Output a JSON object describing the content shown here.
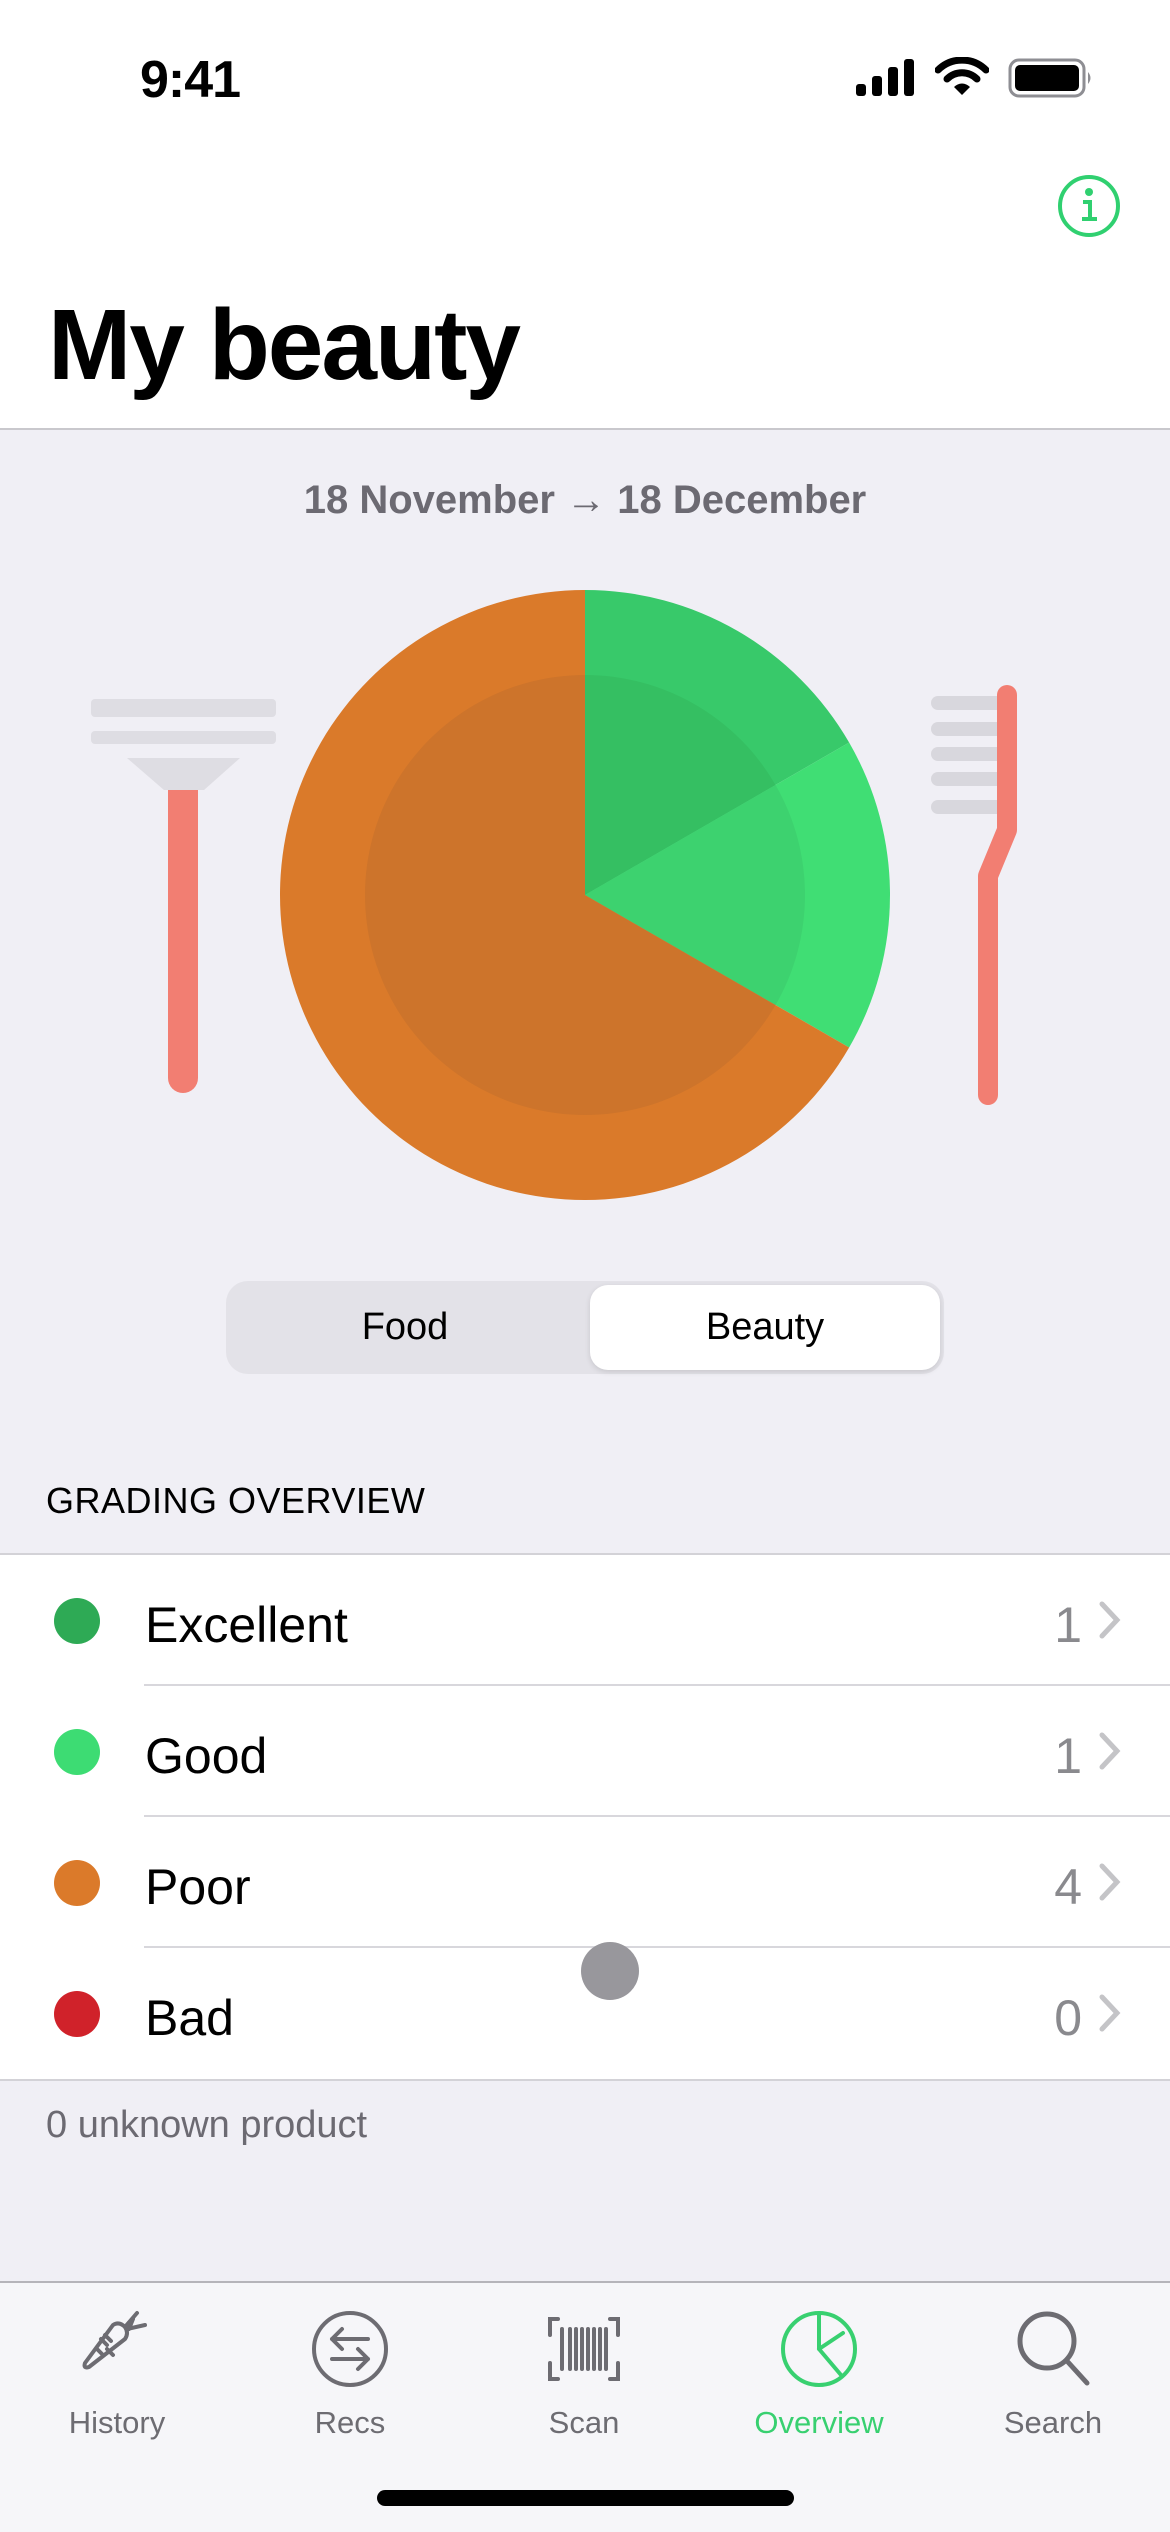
{
  "status_bar": {
    "time": "9:41"
  },
  "header": {
    "title": "My beauty",
    "info_icon": "info-circle-icon"
  },
  "summary": {
    "date_range": "18 November → 18 December",
    "left_utensil_icon": "razor-icon",
    "right_utensil_icon": "toothbrush-icon"
  },
  "segmented": {
    "options": [
      {
        "label": "Food",
        "selected": false
      },
      {
        "label": "Beauty",
        "selected": true
      }
    ]
  },
  "grading": {
    "section_title": "GRADING OVERVIEW",
    "rows": [
      {
        "label": "Excellent",
        "count": "1",
        "color": "#2EAA55"
      },
      {
        "label": "Good",
        "count": "1",
        "color": "#3DDC73"
      },
      {
        "label": "Poor",
        "count": "4",
        "color": "#DB7A2A"
      },
      {
        "label": "Bad",
        "count": "0",
        "color": "#D0222A"
      }
    ],
    "unknown_text": "0 unknown product"
  },
  "chart_data": {
    "type": "pie",
    "title": "",
    "start_angle": "12 o'clock, clockwise",
    "categories": [
      "Excellent",
      "Good",
      "Poor",
      "Bad"
    ],
    "values": [
      1,
      1,
      4,
      0
    ],
    "colors": {
      "Excellent": {
        "outer": "#38C96A",
        "inner": "#35BF62"
      },
      "Good": {
        "outer": "#40DE74",
        "inner": "#3DD26F"
      },
      "Poor": {
        "outer": "#DA7A2A",
        "inner": "#CD742B"
      },
      "Bad": {
        "outer": "#D0222A",
        "inner": "#C2202A"
      }
    }
  },
  "tabbar": {
    "tabs": [
      {
        "label": "History",
        "icon": "carrot-icon",
        "active": false
      },
      {
        "label": "Recs",
        "icon": "swap-arrows-icon",
        "active": false
      },
      {
        "label": "Scan",
        "icon": "barcode-scan-icon",
        "active": false
      },
      {
        "label": "Overview",
        "icon": "pie-chart-icon",
        "active": true
      },
      {
        "label": "Search",
        "icon": "magnifier-icon",
        "active": false
      }
    ]
  },
  "colors": {
    "accent": "#38D070",
    "background": "#F0EFF5",
    "utensil_handle": "#F27E72",
    "utensil_head": "#DEDDE3"
  }
}
